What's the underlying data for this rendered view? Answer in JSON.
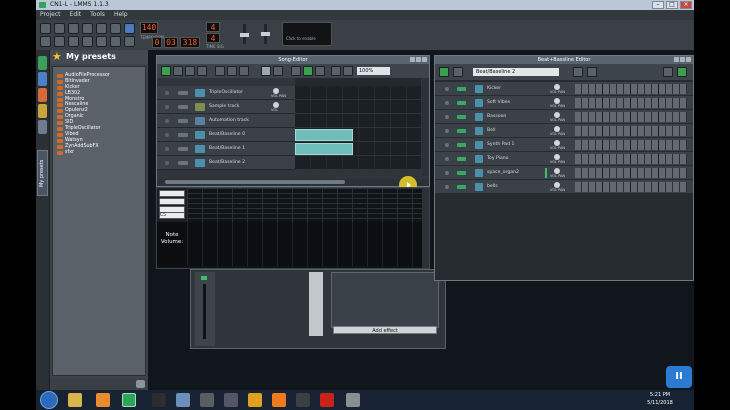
{
  "window": {
    "title": "CN1-L - LMMS 1.1.3"
  },
  "menu": [
    "Project",
    "Edit",
    "Tools",
    "Help"
  ],
  "transport": {
    "tempo": "140",
    "tempo_label": "TEMPO/BPM",
    "min": "0",
    "sec": "03",
    "msec": "318",
    "timesig_top": "4",
    "timesig_bottom": "4",
    "timesig_label": "TIME SIG",
    "enable_text": "Click to enable"
  },
  "sidebar": {
    "title": "My presets",
    "vertical_tab": "My presets",
    "items": [
      "AudioFileProcessor",
      "BitInvader",
      "Kicker",
      "LB302",
      "Monstro",
      "Nescaline",
      "Opulenz2",
      "Organic",
      "SID",
      "TripleOscillator",
      "Vibed",
      "Watsyn",
      "ZynAddSubFX",
      "sfxr"
    ]
  },
  "song_editor": {
    "title": "Song-Editor",
    "zoom": "100%",
    "tracks": [
      {
        "name": "TripleOscillator",
        "knob_label": "VOL PAN"
      },
      {
        "name": "Sample track",
        "knob_label": "VOL"
      },
      {
        "name": "Automation track",
        "knob_label": ""
      },
      {
        "name": "Beat/Baseline 0",
        "knob_label": ""
      },
      {
        "name": "Beat/Baseline 1",
        "knob_label": ""
      },
      {
        "name": "Beat/Baseline 2",
        "knob_label": ""
      }
    ]
  },
  "piano_roll": {
    "key_label": "C5",
    "note_volume_label": "Note Volume:"
  },
  "fx": {
    "add_effect": "Add effect"
  },
  "bb_editor": {
    "title": "Beat+Bassline Editor",
    "selected": "Beat/Baseline 2",
    "tracks": [
      {
        "name": "Kicker",
        "knob_label": "VOL PAN"
      },
      {
        "name": "Soft Vibes",
        "knob_label": "VOL PAN"
      },
      {
        "name": "Bassoon",
        "knob_label": "VOL PAN"
      },
      {
        "name": "Bell",
        "knob_label": "VOL PAN"
      },
      {
        "name": "Synth Pad 1",
        "knob_label": "VOL PAN"
      },
      {
        "name": "Toy Piano",
        "knob_label": "VOL PAN"
      },
      {
        "name": "space_organ2",
        "knob_label": "VOL PAN"
      },
      {
        "name": "bells",
        "knob_label": "VOL PAN"
      }
    ]
  },
  "tray": {
    "time": "5:21 PM",
    "date": "5/11/2018"
  },
  "colors": {
    "accent": "#2fa35b",
    "segment": "#6fbdbb",
    "highlight": "#f3d626"
  }
}
